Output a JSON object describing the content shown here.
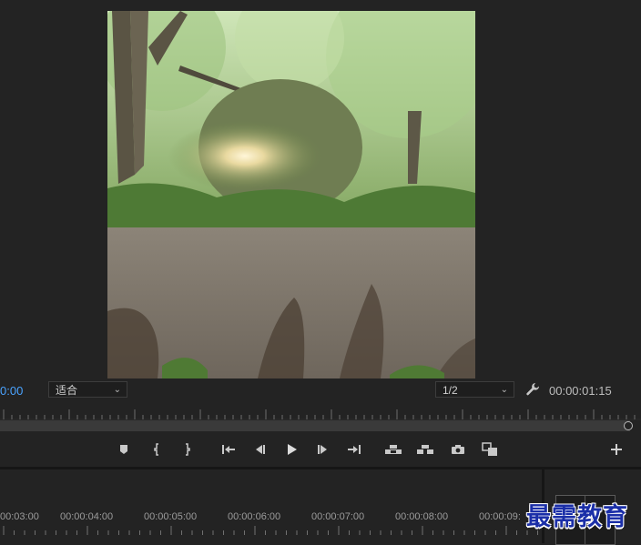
{
  "program_monitor": {
    "current_timecode": "0:00",
    "fit_dropdown": {
      "value": "适合"
    },
    "resolution_dropdown": {
      "value": "1/2"
    },
    "duration_timecode": "00:00:01:15",
    "settings_icon": "wrench-icon"
  },
  "transport": {
    "buttons": [
      {
        "name": "add-marker-button",
        "icon": "marker-icon"
      },
      {
        "name": "mark-in-button",
        "icon": "mark-in-icon"
      },
      {
        "name": "mark-out-button",
        "icon": "mark-out-icon"
      },
      {
        "name": "go-to-in-button",
        "icon": "go-to-in-icon"
      },
      {
        "name": "step-back-button",
        "icon": "step-back-icon"
      },
      {
        "name": "play-button",
        "icon": "play-icon"
      },
      {
        "name": "step-forward-button",
        "icon": "step-forward-icon"
      },
      {
        "name": "go-to-out-button",
        "icon": "go-to-out-icon"
      },
      {
        "name": "lift-button",
        "icon": "lift-icon"
      },
      {
        "name": "extract-button",
        "icon": "extract-icon"
      },
      {
        "name": "export-frame-button",
        "icon": "camera-icon"
      },
      {
        "name": "comparison-view-button",
        "icon": "compare-icon"
      },
      {
        "name": "button-editor-button",
        "icon": "plus-icon"
      }
    ]
  },
  "timeline": {
    "time_labels": [
      "00:03:00",
      "00:00:04:00",
      "00:00:05:00",
      "00:00:06:00",
      "00:00:07:00",
      "00:00:08:00",
      "00:00:09:"
    ]
  },
  "watermark": "最需教育",
  "colors": {
    "background": "#232323",
    "timecode_accent": "#4aa3ff",
    "watermark": "#1b2fa8"
  }
}
